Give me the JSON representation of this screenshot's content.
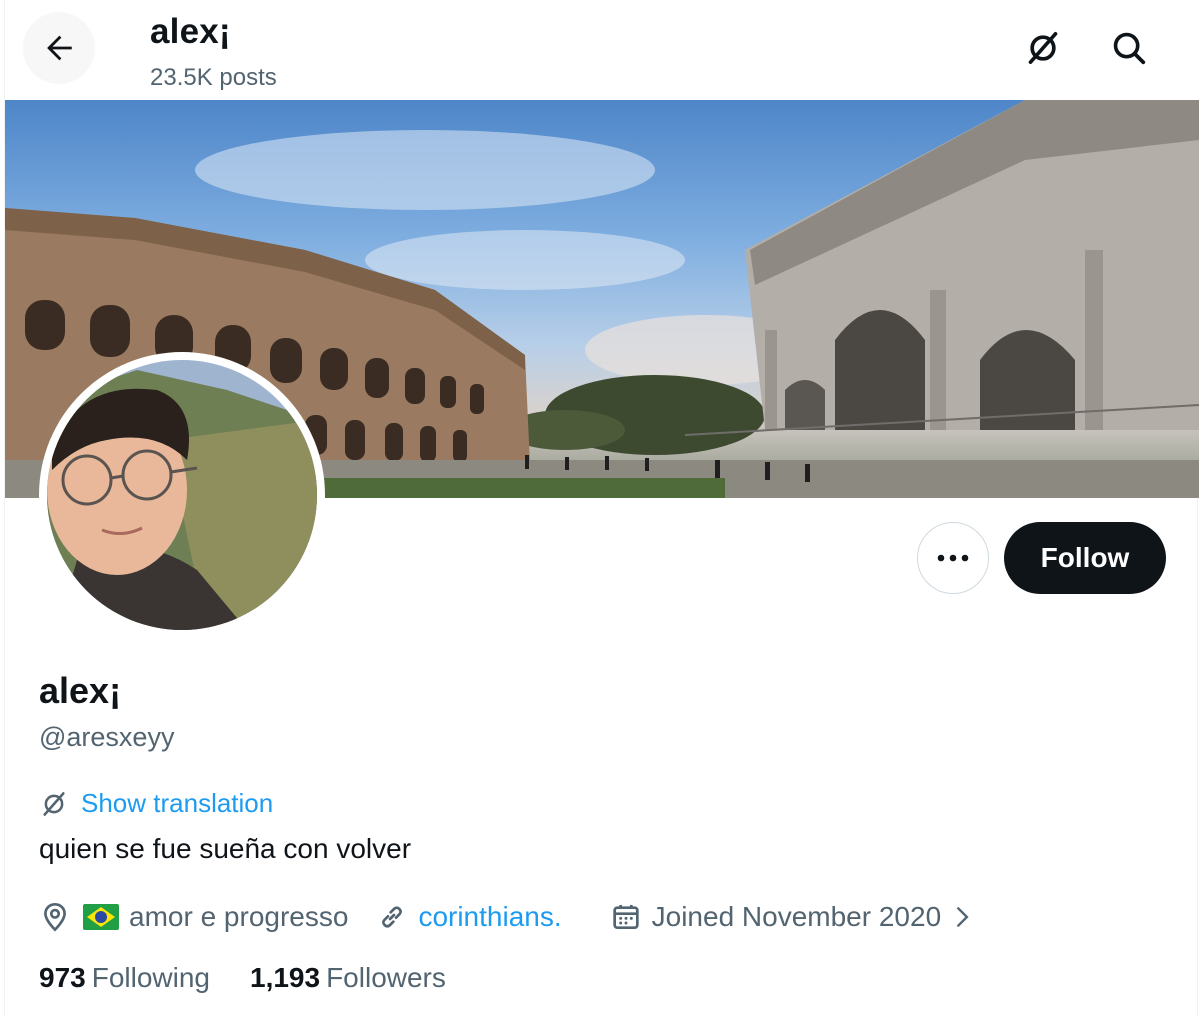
{
  "header": {
    "name": "alex¡",
    "posts": "23.5K posts",
    "icons": [
      "back-arrow-icon",
      "translate-icon",
      "search-icon"
    ]
  },
  "profile": {
    "display_name": "alex¡",
    "handle": "@aresxeyy",
    "show_translation": "Show translation",
    "bio": "quien se fue sueña con volver",
    "location": "amor e progresso",
    "location_flag": "brazil-flag-icon",
    "website": "corinthians.",
    "joined": "Joined November 2020",
    "following_count": "973",
    "following_label": "Following",
    "followers_count": "1,193",
    "followers_label": "Followers"
  },
  "actions": {
    "follow_label": "Follow",
    "more_icon": "more-icon"
  },
  "colors": {
    "accent": "#1d9bf0",
    "text": "#0f1419",
    "secondary": "#536471",
    "follow_bg": "#0f1419"
  }
}
